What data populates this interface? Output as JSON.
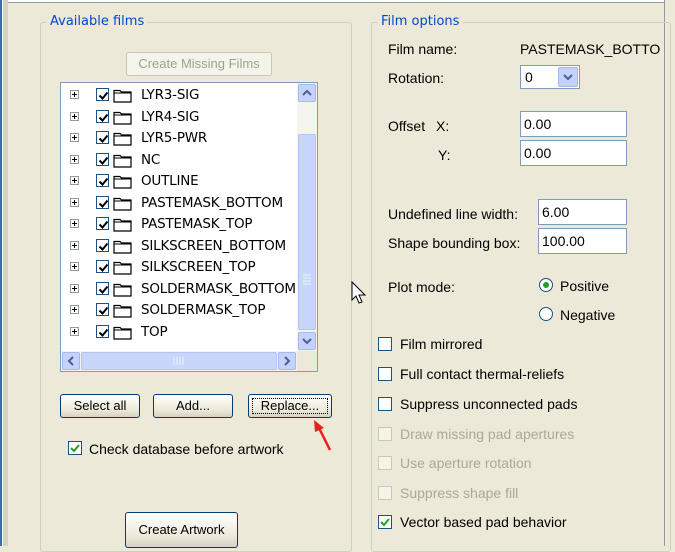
{
  "available_films": {
    "title": "Available films",
    "create_missing_label": "Create Missing Films",
    "films": [
      {
        "name": "LYR3-SIG",
        "checked": true
      },
      {
        "name": "LYR4-SIG",
        "checked": true
      },
      {
        "name": "LYR5-PWR",
        "checked": true
      },
      {
        "name": "NC",
        "checked": true
      },
      {
        "name": "OUTLINE",
        "checked": true
      },
      {
        "name": "PASTEMASK_BOTTOM",
        "checked": true
      },
      {
        "name": "PASTEMASK_TOP",
        "checked": true
      },
      {
        "name": "SILKSCREEN_BOTTOM",
        "checked": true
      },
      {
        "name": "SILKSCREEN_TOP",
        "checked": true
      },
      {
        "name": "SOLDERMASK_BOTTOM",
        "checked": true
      },
      {
        "name": "SOLDERMASK_TOP",
        "checked": true
      },
      {
        "name": "TOP",
        "checked": true
      }
    ],
    "select_all_label": "Select all",
    "add_label": "Add...",
    "replace_label": "Replace...",
    "check_database_label": "Check database before artwork",
    "check_database_checked": true,
    "create_artwork_label": "Create Artwork"
  },
  "film_options": {
    "title": "Film options",
    "film_name_label": "Film name:",
    "film_name_value": "PASTEMASK_BOTTO",
    "rotation_label": "Rotation:",
    "rotation_value": "0",
    "offset_label": "Offset",
    "offset_x_label": "X:",
    "offset_x_value": "0.00",
    "offset_y_label": "Y:",
    "offset_y_value": "0.00",
    "undefined_line_width_label": "Undefined line width:",
    "undefined_line_width_value": "6.00",
    "shape_bounding_box_label": "Shape bounding box:",
    "shape_bounding_box_value": "100.00",
    "plot_mode_label": "Plot mode:",
    "positive_label": "Positive",
    "negative_label": "Negative",
    "plot_mode_selected": "Positive",
    "options": [
      {
        "label": "Film mirrored",
        "checked": false,
        "enabled": true
      },
      {
        "label": "Full contact thermal-reliefs",
        "checked": false,
        "enabled": true
      },
      {
        "label": "Suppress unconnected pads",
        "checked": false,
        "enabled": true
      },
      {
        "label": "Draw missing pad apertures",
        "checked": false,
        "enabled": false
      },
      {
        "label": "Use aperture rotation",
        "checked": false,
        "enabled": false
      },
      {
        "label": "Suppress shape fill",
        "checked": false,
        "enabled": false
      },
      {
        "label": "Vector based pad behavior",
        "checked": true,
        "enabled": true
      }
    ]
  },
  "colors": {
    "group_title": "#0046d5",
    "annotation_arrow": "#e82020",
    "checkmark": "#21a121"
  }
}
